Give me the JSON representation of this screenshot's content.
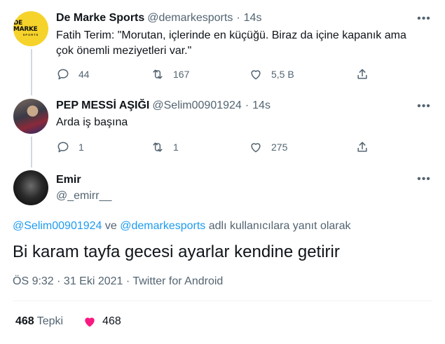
{
  "tweets": [
    {
      "name": "De Marke Sports",
      "handle": "@demarkesports",
      "dot": "·",
      "time": "14s",
      "text": "Fatih Terim: \"Morutan, içlerinde en küçüğü. Biraz da içine kapanık ama çok önemli meziyetleri var.\"",
      "avatar_text_1": "DE MARKE",
      "avatar_text_2": "SPORTS",
      "replies": "44",
      "retweets": "167",
      "likes": "5,5 B"
    },
    {
      "name": "PEP MESSİ AŞIĞI",
      "handle": "@Selim00901924",
      "dot": "·",
      "time": "14s",
      "text": "Arda iş başına",
      "replies": "1",
      "retweets": "1",
      "likes": "275"
    }
  ],
  "focused": {
    "name": "Emir",
    "handle": "@_emirr__",
    "reply_mention_1": "@Selim00901924",
    "reply_and": " ve ",
    "reply_mention_2": "@demarkesports",
    "reply_suffix": " adlı kullanıcılara yanıt olarak",
    "text": "Bi karam tayfa gecesi ayarlar kendine getirir",
    "meta": "ÖS 9:32 · 31 Eki 2021 · Twitter for Android",
    "reaction_count": "468",
    "reaction_label": "Tepki",
    "like_count": "468"
  },
  "icons": [
    "more-icon",
    "reply-icon",
    "retweet-icon",
    "like-icon",
    "share-icon",
    "heart-filled-icon"
  ],
  "colors": {
    "link": "#1d9bf0",
    "heart": "#f91880",
    "muted": "#536471"
  }
}
